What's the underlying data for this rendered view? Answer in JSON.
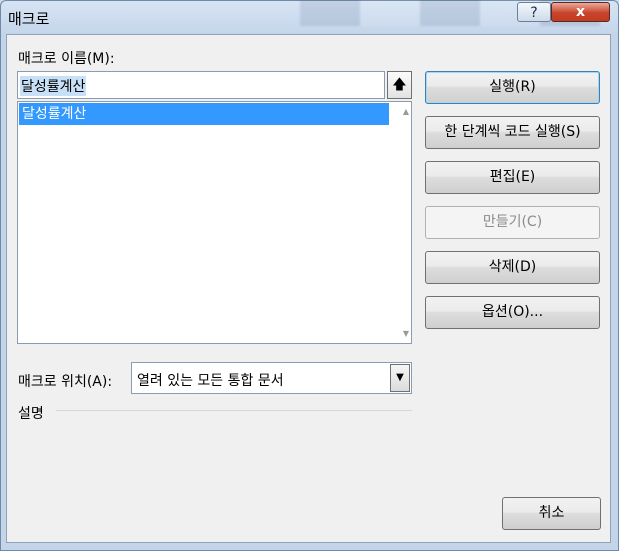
{
  "window": {
    "title": "매크로",
    "help_label": "?",
    "close_label": "x"
  },
  "macro_name": {
    "label": "매크로 이름(M):",
    "value": "달성률계산",
    "up_icon": "up-arrow-icon"
  },
  "macro_list": {
    "items": [
      "달성률계산"
    ],
    "selected": 0
  },
  "buttons": {
    "run": "실행(R)",
    "step_into": "한 단계씩 코드 실행(S)",
    "edit": "편집(E)",
    "create": "만들기(C)",
    "delete": "삭제(D)",
    "options": "옵션(O)...",
    "cancel": "취소"
  },
  "macro_location": {
    "label": "매크로 위치(A):",
    "value": "열려 있는 모든 통합 문서"
  },
  "description": {
    "label": "설명"
  }
}
